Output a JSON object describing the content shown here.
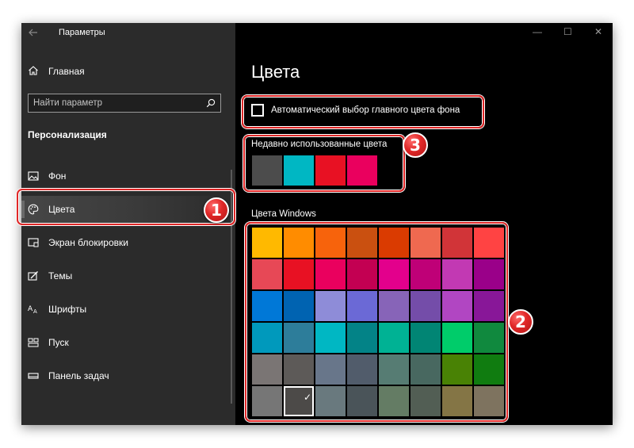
{
  "window": {
    "title": "Параметры",
    "controls": {
      "minimize": "—",
      "maximize": "☐",
      "close": "✕"
    }
  },
  "sidebar": {
    "home_label": "Главная",
    "search_placeholder": "Найти параметр",
    "section_title": "Персонализация",
    "items": [
      {
        "label": "Фон",
        "icon": "picture-icon"
      },
      {
        "label": "Цвета",
        "icon": "palette-icon",
        "selected": true
      },
      {
        "label": "Экран блокировки",
        "icon": "lock-screen-icon"
      },
      {
        "label": "Темы",
        "icon": "themes-icon"
      },
      {
        "label": "Шрифты",
        "icon": "fonts-icon"
      },
      {
        "label": "Пуск",
        "icon": "start-icon"
      },
      {
        "label": "Панель задач",
        "icon": "taskbar-icon"
      }
    ]
  },
  "main": {
    "heading": "Цвета",
    "auto_color_label": "Автоматический выбор главного цвета фона",
    "auto_color_checked": false,
    "recent_label": "Недавно использованные цвета",
    "recent_colors": [
      "#4c4c4c",
      "#00b7c3",
      "#e81123",
      "#ea005e"
    ],
    "windows_colors_label": "Цвета Windows",
    "windows_colors": [
      [
        "#ffb900",
        "#ff8c00",
        "#f7630c",
        "#ca5010",
        "#da3b01",
        "#ef6950",
        "#d13438",
        "#ff4343"
      ],
      [
        "#e74856",
        "#e81123",
        "#ea005e",
        "#c30052",
        "#e3008c",
        "#bf0077",
        "#c239b3",
        "#9a0089"
      ],
      [
        "#0078d7",
        "#0063b1",
        "#8e8cd8",
        "#6b69d6",
        "#8764b8",
        "#744da9",
        "#b146c2",
        "#881798"
      ],
      [
        "#0099bc",
        "#2d7d9a",
        "#00b7c3",
        "#038387",
        "#00b294",
        "#018574",
        "#00cc6a",
        "#10893e"
      ],
      [
        "#7a7574",
        "#5d5a58",
        "#68768a",
        "#515c6b",
        "#567c73",
        "#486860",
        "#498205",
        "#107c10"
      ],
      [
        "#767676",
        "#4c4a48",
        "#69797e",
        "#4a5459",
        "#647c64",
        "#525e54",
        "#847545",
        "#7e735f"
      ]
    ],
    "selected_color": "#4c4a48"
  },
  "annotations": [
    {
      "number": "1"
    },
    {
      "number": "2"
    },
    {
      "number": "3"
    }
  ]
}
